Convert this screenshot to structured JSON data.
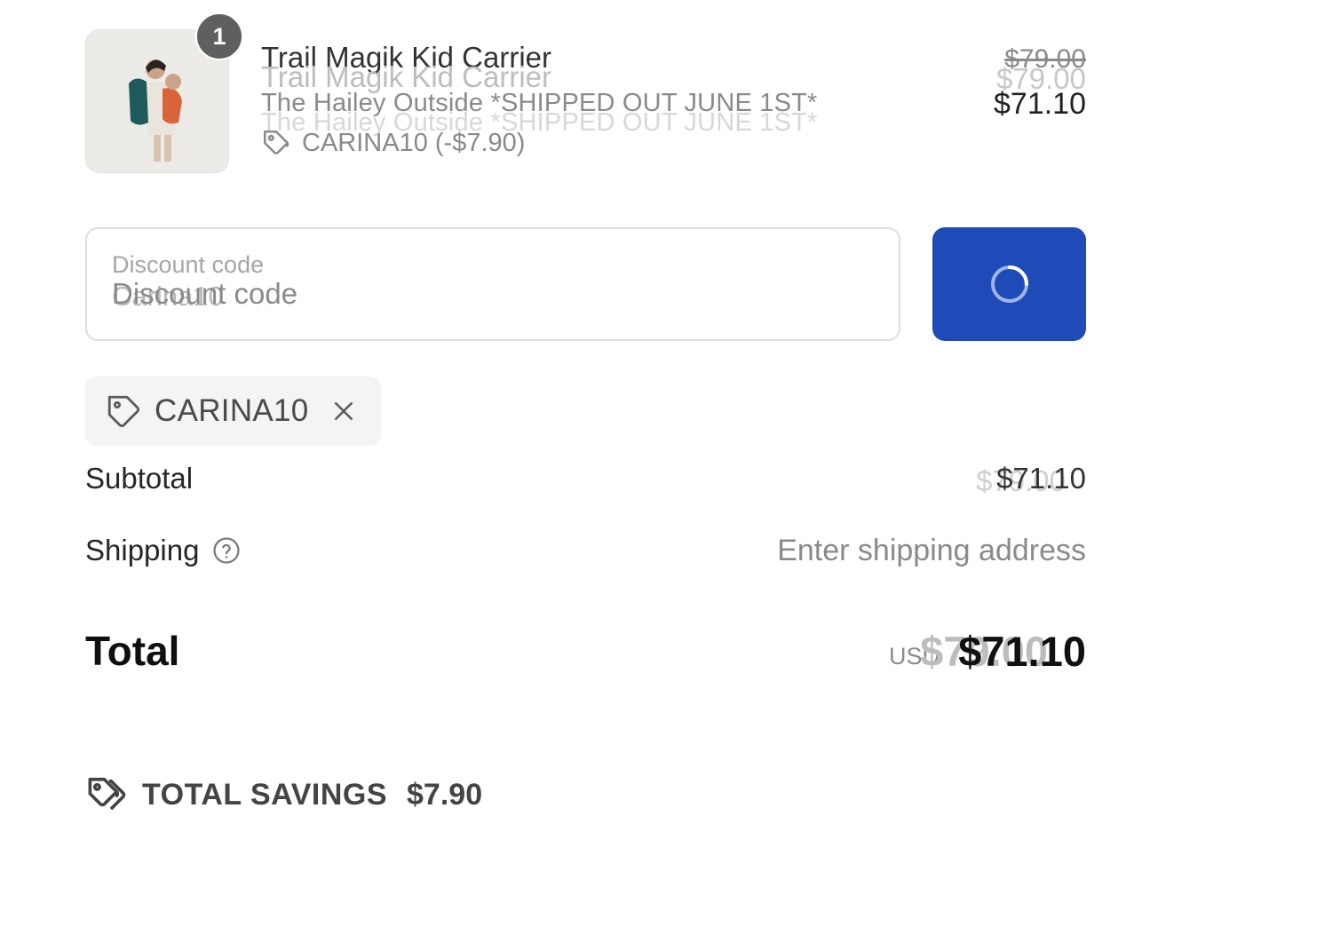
{
  "line_item": {
    "quantity": "1",
    "title": "Trail Magik Kid Carrier",
    "variant": "The Hailey Outside *SHIPPED OUT JUNE 1ST*",
    "discount_applied": "CARINA10 (-$7.90)",
    "original_price": "$79.00",
    "sale_price": "$71.10",
    "thumbnail_icon": "product-photo-parent-with-child-carrier"
  },
  "discount_field": {
    "label": "Discount code",
    "value": "Carina10",
    "placeholder": "Discount code",
    "apply_state_icon": "loading-spinner"
  },
  "applied_code": {
    "code": "CARINA10",
    "remove_icon": "close-icon"
  },
  "summary": {
    "subtotal_label": "Subtotal",
    "subtotal_value": "$71.10",
    "subtotal_previous": "$79.00",
    "shipping_label": "Shipping",
    "shipping_value": "Enter shipping address",
    "total_label": "Total",
    "currency": "USD",
    "total_value": "$71.10",
    "total_previous": "$79.00"
  },
  "savings": {
    "label": "TOTAL SAVINGS",
    "amount": "$7.90"
  },
  "colors": {
    "accent": "#1f4bb8",
    "text": "#1a1a1a",
    "muted": "#8a8a8a"
  }
}
